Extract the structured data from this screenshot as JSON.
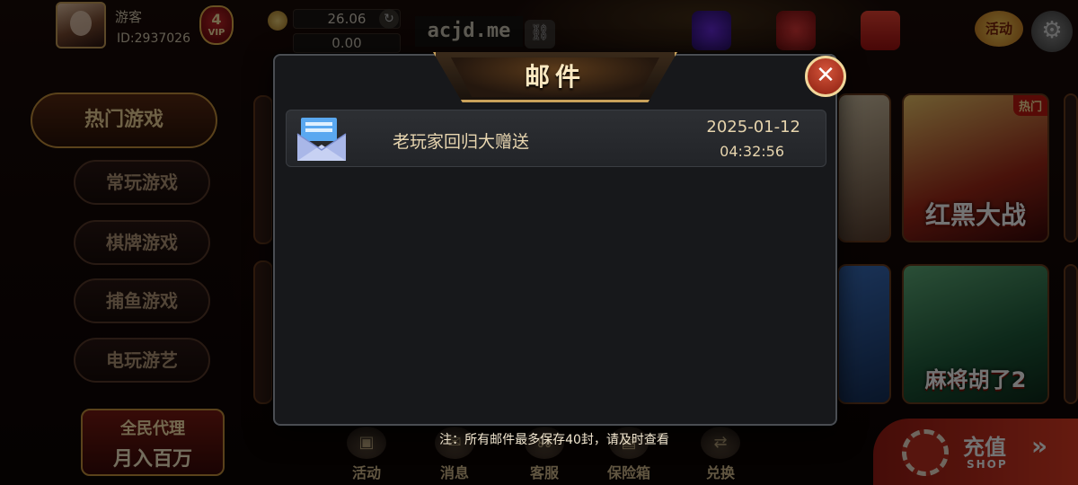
{
  "header": {
    "nickname": "游客",
    "user_id": "ID:2937026",
    "vip_level": "4",
    "vip_label": "VIP",
    "balance": "26.06",
    "bank_balance": "0.00",
    "domain": "acjd.me",
    "activity_label": "活动"
  },
  "sidebar": {
    "items": [
      {
        "label": "热门游戏"
      },
      {
        "label": "常玩游戏"
      },
      {
        "label": "棋牌游戏"
      },
      {
        "label": "捕鱼游戏"
      },
      {
        "label": "电玩游艺"
      }
    ],
    "agent_line1": "全民代理",
    "agent_line2": "月入百万"
  },
  "games": [
    {
      "badge": "热门",
      "title": "红黑大战"
    },
    {
      "title": "麻将胡了2"
    }
  ],
  "bottom_nav": [
    {
      "label": "活动"
    },
    {
      "label": "消息"
    },
    {
      "label": "客服"
    },
    {
      "label": "保险箱"
    },
    {
      "label": "兑换"
    }
  ],
  "recharge": {
    "label": "充值",
    "sub": "SHOP"
  },
  "modal": {
    "title": "邮件",
    "close_symbol": "✕",
    "mails": [
      {
        "subject": "老玩家回归大赠送",
        "date": "2025-01-12",
        "time": "04:32:56"
      }
    ],
    "note": "注：所有邮件最多保存40封，请及时查看"
  },
  "colors": {
    "modal_bg": "#17181b",
    "gold_accent": "#c9a15a",
    "close_red": "#b13a24",
    "recharge_red": "#e03c24"
  }
}
